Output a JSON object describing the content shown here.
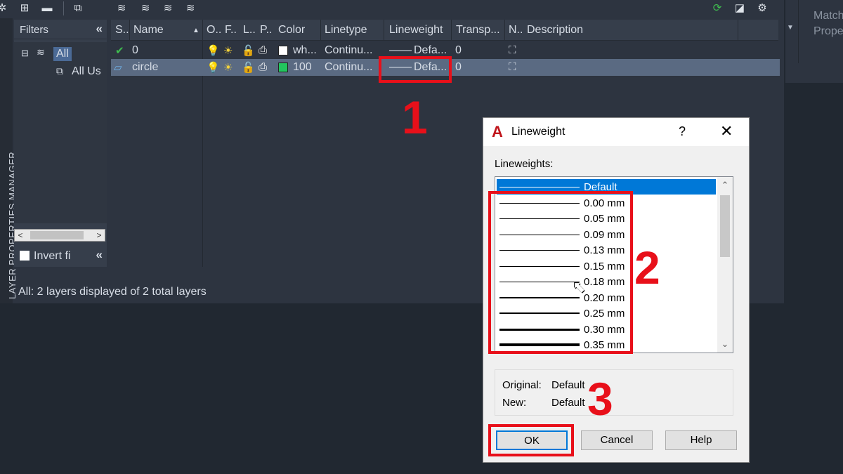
{
  "palette": {
    "side_title": "LAYER PROPERTIES MANAGER",
    "filters": {
      "header": "Filters",
      "collapse_glyph": "«",
      "tree": {
        "all": "All",
        "all_used": "All Us"
      },
      "invert_label": "Invert fi"
    },
    "columns": [
      "S..",
      "Name",
      "O..",
      "F..",
      "L..",
      "P..",
      "Color",
      "Linetype",
      "Lineweight",
      "Transp...",
      "N..",
      "Description"
    ],
    "layers": [
      {
        "status_icon": "check-icon",
        "name": "0",
        "color_hex": "#ffffff",
        "color": "wh...",
        "linetype": "Continu...",
        "lineweight": "Defa...",
        "transparency": "0",
        "selected": false
      },
      {
        "status_icon": "layer-icon",
        "name": "circle",
        "color_hex": "#22c55e",
        "color": "100",
        "linetype": "Continu...",
        "lineweight": "Defa...",
        "transparency": "0",
        "selected": true
      }
    ],
    "status_text": "All: 2 layers displayed of 2 total layers",
    "right_panel_text": [
      "Match",
      "Propert"
    ]
  },
  "annotations": {
    "step1": "1",
    "step2": "2",
    "step3": "3",
    "color": "#e8101a"
  },
  "dialog": {
    "title": "Lineweight",
    "help": "?",
    "close": "✕",
    "list_label": "Lineweights:",
    "items": [
      {
        "label": "Default",
        "weight": 1,
        "selected": true
      },
      {
        "label": "0.00 mm",
        "weight": 1
      },
      {
        "label": "0.05 mm",
        "weight": 1
      },
      {
        "label": "0.09 mm",
        "weight": 1
      },
      {
        "label": "0.13 mm",
        "weight": 1
      },
      {
        "label": "0.15 mm",
        "weight": 1
      },
      {
        "label": "0.18 mm",
        "weight": 1
      },
      {
        "label": "0.20 mm",
        "weight": 2
      },
      {
        "label": "0.25 mm",
        "weight": 2
      },
      {
        "label": "0.30 mm",
        "weight": 3
      },
      {
        "label": "0.35 mm",
        "weight": 4
      }
    ],
    "original_label": "Original:",
    "original_value": "Default",
    "new_label": "New:",
    "new_value": "Default",
    "ok": "OK",
    "cancel": "Cancel",
    "help_button": "Help"
  }
}
